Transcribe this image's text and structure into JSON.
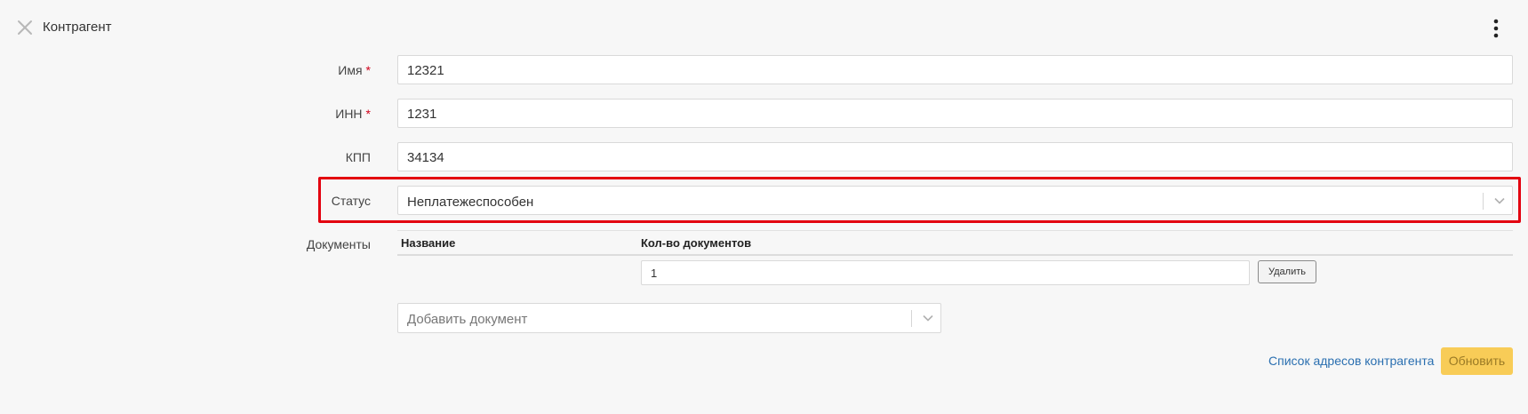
{
  "header": {
    "title": "Контрагент"
  },
  "form": {
    "name": {
      "label": "Имя",
      "required_mark": "*",
      "value": "12321"
    },
    "inn": {
      "label": "ИНН",
      "required_mark": "*",
      "value": "1231"
    },
    "kpp": {
      "label": "КПП",
      "value": "34134"
    },
    "status": {
      "label": "Статус",
      "value": "Неплатежеспособен"
    },
    "documents": {
      "label": "Документы",
      "columns": [
        "Название",
        "Кол-во документов"
      ],
      "rows": [
        {
          "name": "",
          "count": "1",
          "delete_label": "Удалить"
        }
      ],
      "add_placeholder": "Добавить документ"
    }
  },
  "footer": {
    "addresses_link": "Список адресов контрагента",
    "update_label": "Обновить"
  },
  "colors": {
    "highlight": "#e3000f",
    "link": "#2a6fb0",
    "update_button": "#f8cc57",
    "required": "#d0021b"
  }
}
